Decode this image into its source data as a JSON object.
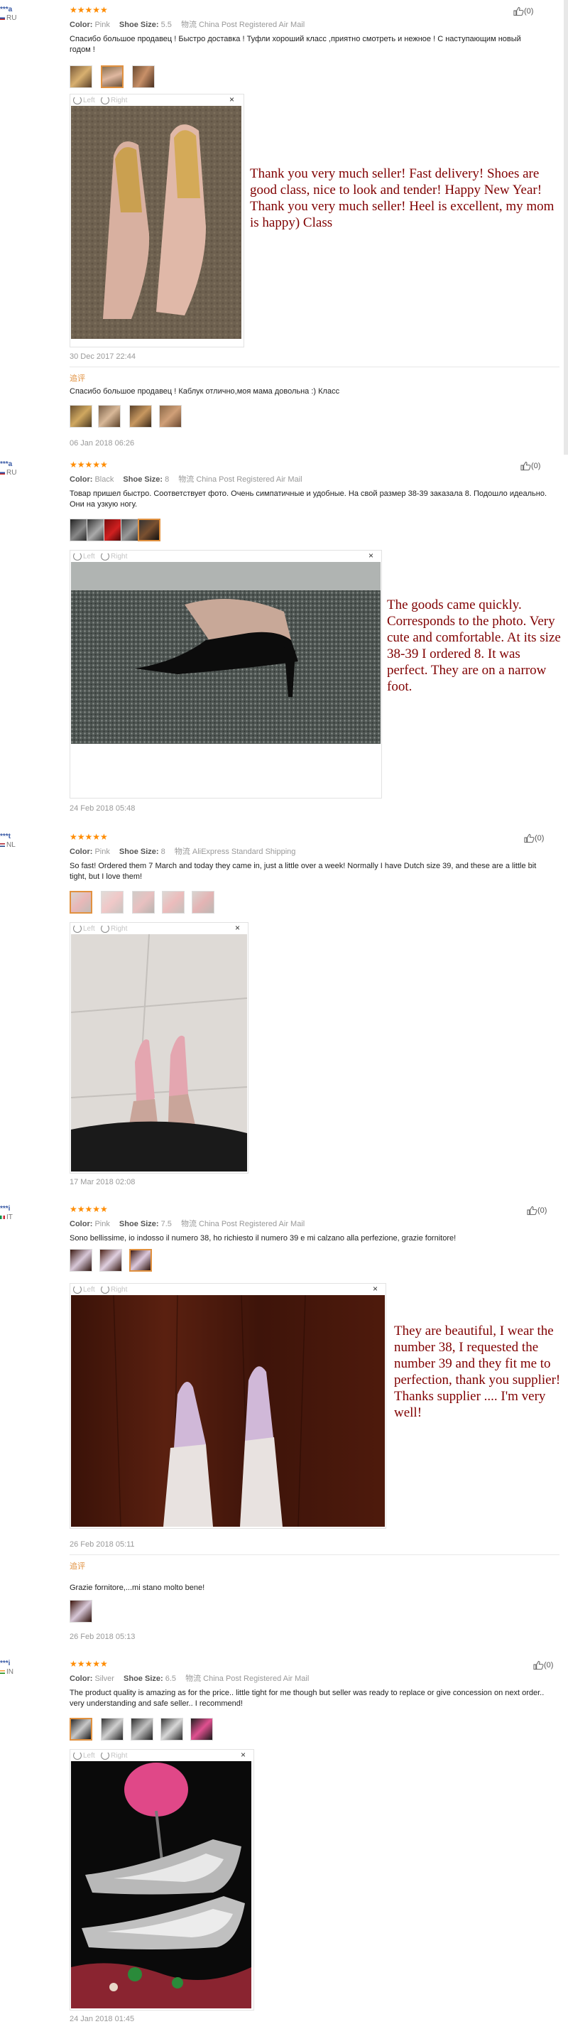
{
  "colors": {
    "star": "#ff8c00",
    "caption": "#800000",
    "link": "#3a5ba6",
    "accent": "#e1913f"
  },
  "viewer": {
    "left_label": "Left",
    "right_label": "Right",
    "close": "×"
  },
  "reviews": [
    {
      "user": "***a",
      "country": "RU",
      "stars": "★★★★★",
      "likes": "(0)",
      "meta": {
        "color_label": "Color:",
        "color": "Pink",
        "size_label": "Shoe Size:",
        "size": "5.5",
        "ship_label": "物流",
        "ship": "China Post Registered Air Mail"
      },
      "text": "Спасибо большое продавец ! Быстро доставка ! Туфли хороший класс ,приятно смотреть и нежное ! С наступающим новый годом !",
      "caption": "Thank you very much seller! Fast delivery! Shoes are good class, nice to look and tender! Happy New Year!\nThank you very much seller! Heel is excellent, my mom is happy) Class",
      "date": "30 Dec 2017 22:44",
      "append_label": "追评",
      "append_text": "Спасибо большое продавец ! Каблук отлично,моя мама довольна :) Класс",
      "append_date": "06 Jan 2018 06:26"
    },
    {
      "user": "***a",
      "country": "RU",
      "stars": "★★★★★",
      "likes": "(0)",
      "meta": {
        "color_label": "Color:",
        "color": "Black",
        "size_label": "Shoe Size:",
        "size": "8",
        "ship_label": "物流",
        "ship": "China Post Registered Air Mail"
      },
      "text": "Товар пришел быстро. Соответствует фото. Очень симпатичные и удобные. На свой размер 38-39 заказала 8. Подошло идеально. Они на узкую ногу.",
      "caption": "The goods came quickly. Corresponds to the photo. Very cute and comfortable. At its size 38-39 I ordered 8. It was perfect. They are on a narrow foot.",
      "date": "24 Feb 2018 05:48"
    },
    {
      "user": "***t",
      "country": "NL",
      "stars": "★★★★★",
      "likes": "(0)",
      "meta": {
        "color_label": "Color:",
        "color": "Pink",
        "size_label": "Shoe Size:",
        "size": "8",
        "ship_label": "物流",
        "ship": "AliExpress Standard Shipping"
      },
      "text": "So fast! Ordered them 7 March and today they came in, just a little over a week! Normally I have Dutch size 39, and these are a little bit tight, but I love them!",
      "date": "17 Mar 2018 02:08"
    },
    {
      "user": "***i",
      "country": "IT",
      "stars": "★★★★★",
      "likes": "(0)",
      "meta": {
        "color_label": "Color:",
        "color": "Pink",
        "size_label": "Shoe Size:",
        "size": "7.5",
        "ship_label": "物流",
        "ship": "China Post Registered Air Mail"
      },
      "text": "Sono bellissime, io indosso il numero 38, ho richiesto il numero 39 e mi calzano alla perfezione, grazie fornitore!",
      "caption": "They are beautiful, I wear the number 38, I requested the number 39 and they fit me to perfection, thank you supplier!\nThanks supplier .... I'm very well!",
      "date": "26 Feb 2018 05:11",
      "append_label": "追评",
      "append_text": "Grazie fornitore,...mi stano molto bene!",
      "append_date": "26 Feb 2018 05:13"
    },
    {
      "user": "***i",
      "country": "IN",
      "stars": "★★★★★",
      "likes": "(0)",
      "meta": {
        "color_label": "Color:",
        "color": "Silver",
        "size_label": "Shoe Size:",
        "size": "6.5",
        "ship_label": "物流",
        "ship": "China Post Registered Air Mail"
      },
      "text": "The product quality is amazing as for the price.. little tight for me though but seller was ready to replace or give concession on next order.. very understanding and safe seller.. I recommend!",
      "date": "24 Jan 2018 01:45"
    }
  ]
}
